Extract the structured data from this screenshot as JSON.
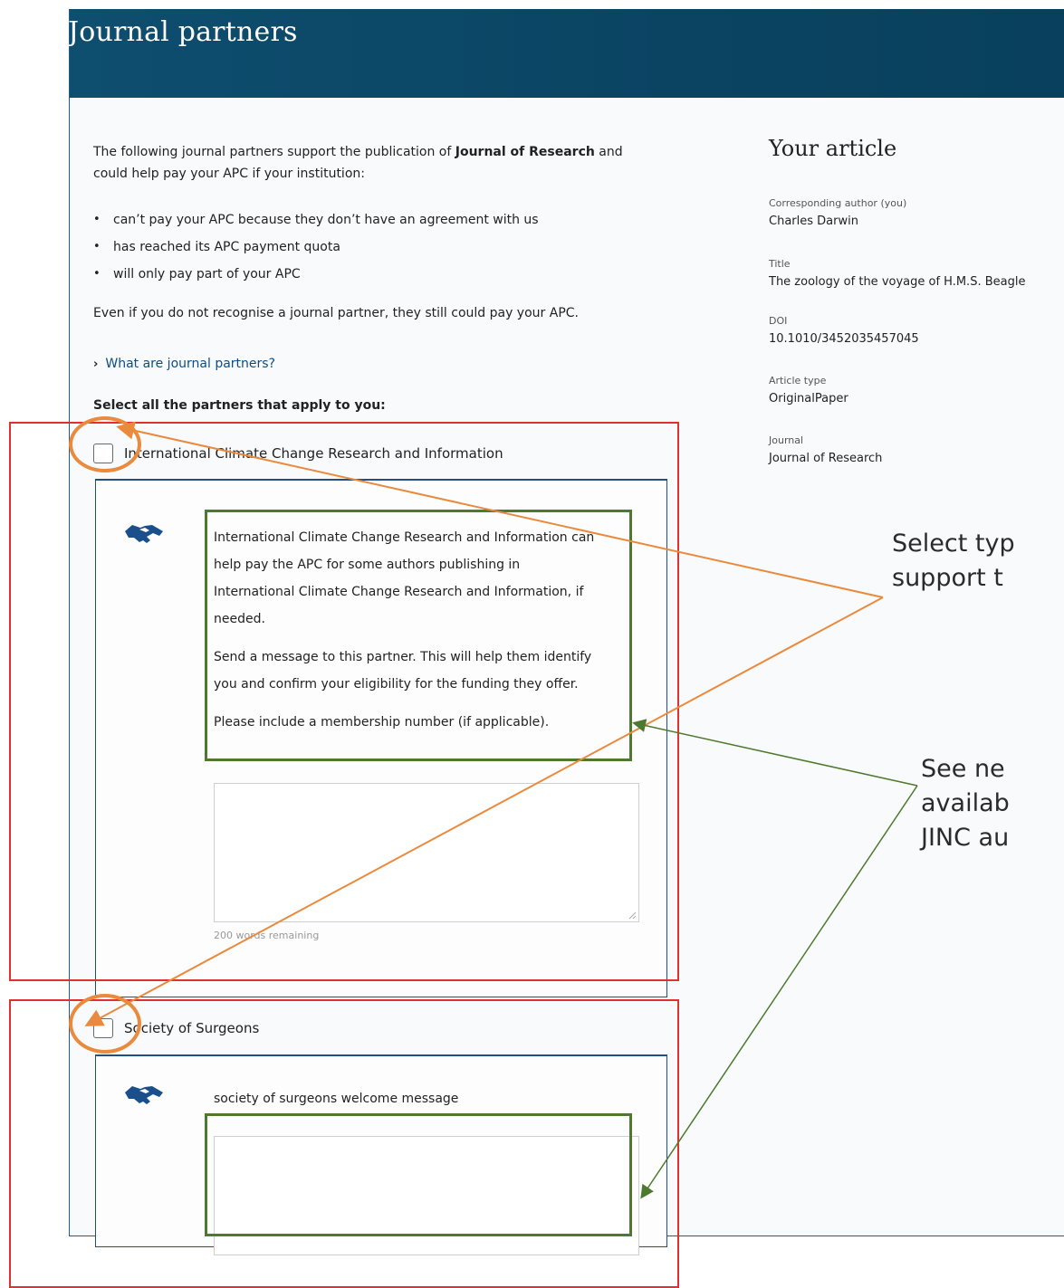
{
  "header": {
    "title": "Journal partners"
  },
  "intro": {
    "text_before": "The following journal partners support the publication of ",
    "journal_name": "Journal of Research",
    "text_after_1": " and",
    "line_2": "could help pay your APC if your institution:",
    "bullets": [
      "can’t pay your APC because they don’t have an agreement with us",
      "has reached its APC payment quota",
      "will only pay part of your APC"
    ],
    "recognise_note": "Even if you do not recognise a journal partner, they still could pay your APC.",
    "expander_label": "What are journal partners?",
    "select_heading": "Select all the partners that apply to you:"
  },
  "partners": [
    {
      "name": "International Climate Change Research and Information",
      "message_lines": [
        "International Climate Change Research and Information can",
        "help pay the APC for some authors publishing in",
        "International Climate Change Research and Information, if",
        "needed."
      ],
      "send_lines": [
        "Send a message to this partner. This will help them identify",
        "you and confirm your eligibility for the funding they offer."
      ],
      "membership_note": "Please include a membership number (if applicable).",
      "counter": "200 words remaining",
      "icon": "handshake-icon"
    },
    {
      "name": "Society of Surgeons",
      "message": "society of surgeons welcome message",
      "icon": "handshake-icon"
    }
  ],
  "sidebar": {
    "title": "Your article",
    "fields": [
      {
        "label": "Corresponding author (you)",
        "value": "Charles Darwin"
      },
      {
        "label": "Title",
        "value": "The zoology of the voyage of H.M.S. Beagle"
      },
      {
        "label": "DOI",
        "value": "10.1010/3452035457045"
      },
      {
        "label": "Article type",
        "value": "OriginalPaper"
      },
      {
        "label": "Journal",
        "value": "Journal of Research"
      }
    ]
  },
  "annotations": {
    "select_type": [
      "Select typ",
      "support t"
    ],
    "see_new": [
      "See ne",
      "availab",
      "JINC au"
    ]
  },
  "colors": {
    "header": "#0b4463",
    "link": "#0c4d85",
    "annotation_red": "#e23030",
    "annotation_green": "#4d7a2e",
    "annotation_orange": "#ea8a3d"
  }
}
